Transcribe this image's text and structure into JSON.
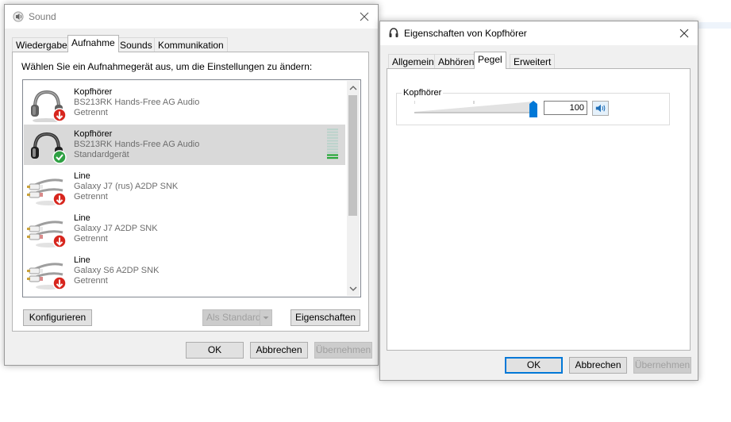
{
  "sound": {
    "title": "Sound",
    "tabs": [
      "Wiedergabe",
      "Aufnahme",
      "Sounds",
      "Kommunikation"
    ],
    "active_tab": 1,
    "instruction": "Wählen Sie ein Aufnahmegerät aus, um die Einstellungen zu ändern:",
    "devices": [
      {
        "name": "Kopfhörer",
        "description": "BS213RK Hands-Free AG Audio",
        "status": "Getrennt",
        "icon": "headset-icon",
        "badge": "disconnected-arrow-badge",
        "selected": false
      },
      {
        "name": "Kopfhörer",
        "description": "BS213RK Hands-Free AG Audio",
        "status": "Standardgerät",
        "icon": "headset-icon",
        "badge": "default-check-badge",
        "selected": true
      },
      {
        "name": "Line",
        "description": "Galaxy J7 (rus) A2DP SNK",
        "status": "Getrennt",
        "icon": "rca-cable-icon",
        "badge": "disconnected-arrow-badge",
        "selected": false
      },
      {
        "name": "Line",
        "description": "Galaxy J7 A2DP SNK",
        "status": "Getrennt",
        "icon": "rca-cable-icon",
        "badge": "disconnected-arrow-badge",
        "selected": false
      },
      {
        "name": "Line",
        "description": "Galaxy S6 A2DP SNK",
        "status": "Getrennt",
        "icon": "rca-cable-icon",
        "badge": "disconnected-arrow-badge",
        "selected": false
      }
    ],
    "buttons": {
      "configure": "Konfigurieren",
      "set_default": "Als Standard",
      "properties": "Eigenschaften",
      "ok": "OK",
      "cancel": "Abbrechen",
      "apply": "Übernehmen"
    }
  },
  "props": {
    "title": "Eigenschaften von Kopfhörer",
    "tabs": [
      "Allgemein",
      "Abhören",
      "Pegel",
      "Erweitert"
    ],
    "active_tab": 2,
    "group_label": "Kopfhörer",
    "level_value": "100",
    "level_fraction": 1.0,
    "buttons": {
      "ok": "OK",
      "cancel": "Abbrechen",
      "apply": "Übernehmen"
    }
  },
  "colors": {
    "accent": "#0078d7",
    "meter_active": "#27a83a",
    "meter_idle": "#bcd3cc",
    "badge_red": "#d7261e",
    "badge_green": "#2ea043"
  }
}
